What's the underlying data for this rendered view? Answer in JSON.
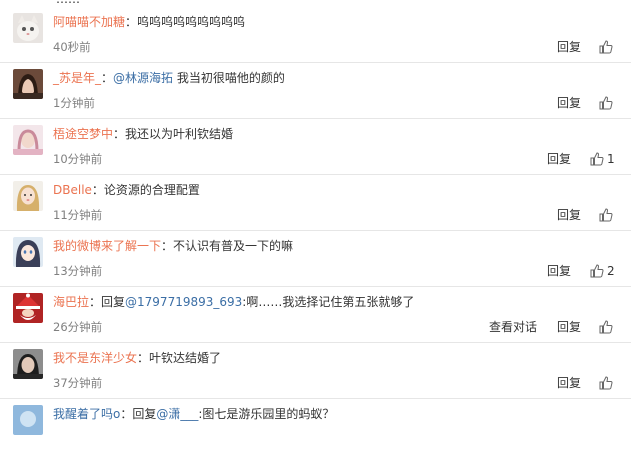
{
  "top_partial_text": "……",
  "actions": {
    "reply_label": "回复",
    "view_dialog_label": "查看对话"
  },
  "comments": [
    {
      "user": "阿喵喵不加糖",
      "text": "呜呜呜呜呜呜呜呜呜",
      "time": "40秒前",
      "likes": "",
      "icon": "cat-avatar"
    },
    {
      "user": "_苏是年_",
      "mention": "@林源海拓",
      "text": " 我当初很喵他的颜的",
      "time": "1分钟前",
      "likes": "",
      "icon": "girl-avatar"
    },
    {
      "user": "梧途空梦中",
      "text": "：我还以为叶利钦结婚",
      "time": "10分钟前",
      "likes": "1",
      "icon": "pink-girl-avatar"
    },
    {
      "user": "DBelle",
      "text": "：论资源的合理配置",
      "time": "11分钟前",
      "likes": "",
      "icon": "blonde-avatar"
    },
    {
      "user": "我的微博来了解一下",
      "text": "：不认识有普及一下的嘛",
      "time": "13分钟前",
      "likes": "2",
      "icon": "anime-avatar"
    },
    {
      "user": "海巴拉",
      "reply_prefix": "：回复",
      "mention": "@1797719893_693",
      "text": ":啊……我选择记住第五张就够了",
      "time": "26分钟前",
      "likes": "",
      "view_dialog": true,
      "icon": "santa-avatar"
    },
    {
      "user": "我不是东洋少女",
      "text": "：叶钦达结婚了",
      "time": "37分钟前",
      "likes": "",
      "icon": "dark-girl-avatar"
    },
    {
      "user": "我醒着了吗o",
      "reply_prefix": "：回复",
      "mention": "@潇___",
      "text": ":图七是游乐园里的蚂蚁？",
      "time": "",
      "likes": "",
      "icon": "blue-avatar"
    }
  ],
  "colors": {
    "username": "#eb7350",
    "mention": "#3b6ea5",
    "text": "#333333",
    "time": "#808080",
    "divider": "#e6e6e6"
  }
}
